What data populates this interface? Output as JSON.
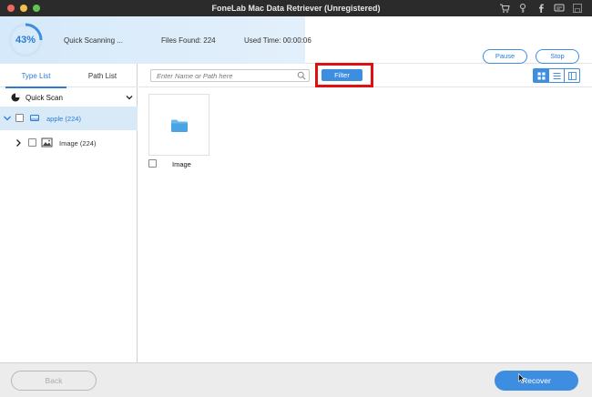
{
  "window": {
    "title": "FoneLab Mac Data Retriever (Unregistered)"
  },
  "scan": {
    "percent_label": "43%",
    "percent_value": 0.43,
    "status": "Quick Scanning ...",
    "files_found": "Files Found: 224",
    "used_time": "Used Time: 00:00:06",
    "pause_label": "Pause",
    "stop_label": "Stop"
  },
  "sidebar": {
    "tabs": [
      {
        "label": "Type List",
        "active": true
      },
      {
        "label": "Path List",
        "active": false
      }
    ],
    "section_label": "Quick Scan",
    "drive_label": "apple (224)",
    "category_label": "Image (224)"
  },
  "main": {
    "search_placeholder": "Enter Name or Path here",
    "filter_label": "Filter",
    "items": [
      {
        "label": "Image",
        "icon": "folder-icon"
      }
    ]
  },
  "footer": {
    "back_label": "Back",
    "recover_label": "Recover"
  },
  "colors": {
    "accent": "#3d8ee0",
    "highlight": "#e01010",
    "selected_row": "#d8e9f8"
  }
}
